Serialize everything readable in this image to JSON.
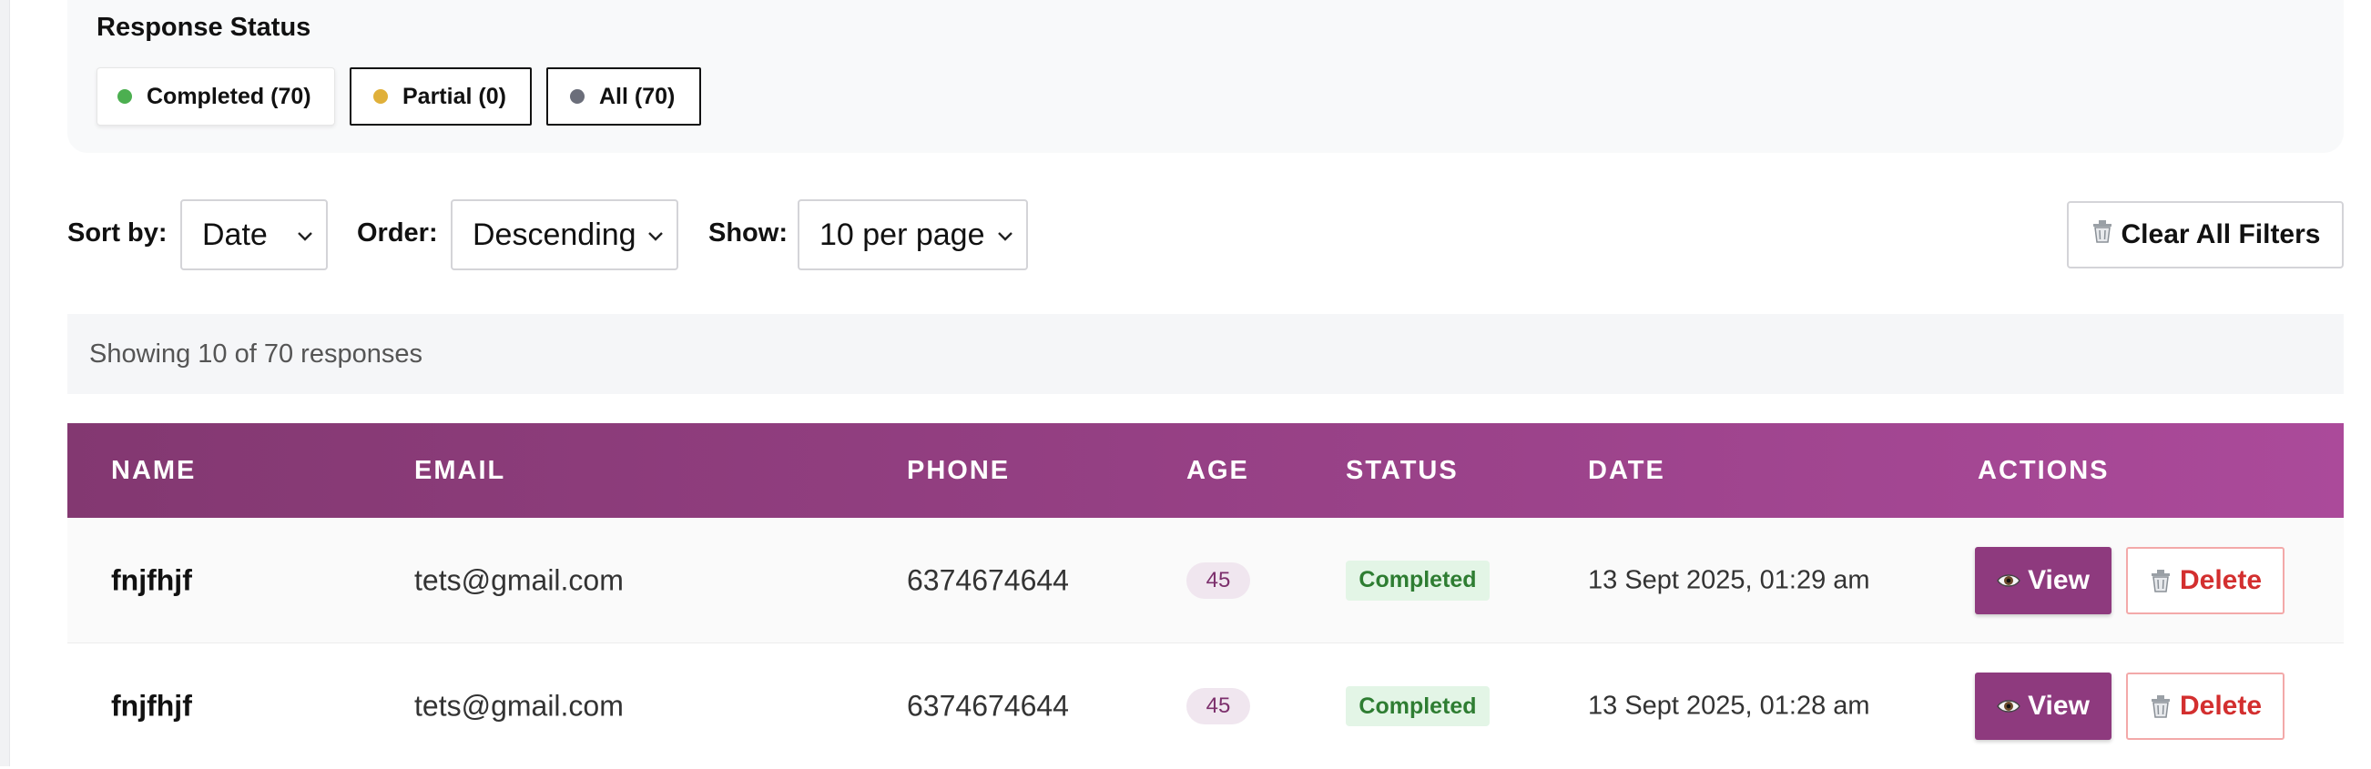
{
  "status_filter": {
    "title": "Response Status",
    "chips": [
      {
        "label": "Completed (70)",
        "color": "#4caf50"
      },
      {
        "label": "Partial (0)",
        "color": "#e0b03a"
      },
      {
        "label": "All (70)",
        "color": "#6b6e7a"
      }
    ]
  },
  "controls": {
    "sort_label": "Sort by:",
    "sort_value": "Date",
    "order_label": "Order:",
    "order_value": "Descending",
    "show_label": "Show:",
    "show_value": "10 per page",
    "clear_label": "Clear All Filters",
    "clear_icon": "trash-icon"
  },
  "summary": "Showing 10 of 70 responses",
  "table": {
    "headers": [
      "NAME",
      "EMAIL",
      "PHONE",
      "AGE",
      "STATUS",
      "DATE",
      "ACTIONS"
    ],
    "rows": [
      {
        "name": "fnjfhjf",
        "email": "tets@gmail.com",
        "phone": "6374674644",
        "age": "45",
        "status": "Completed",
        "date": "13 Sept 2025, 01:29 am"
      },
      {
        "name": "fnjfhjf",
        "email": "tets@gmail.com",
        "phone": "6374674644",
        "age": "45",
        "status": "Completed",
        "date": "13 Sept 2025, 01:28 am"
      }
    ],
    "view_label": "View",
    "delete_label": "Delete",
    "view_icon": "eye-icon",
    "delete_icon": "trash-icon"
  },
  "colors": {
    "accent": "#8e3a7e",
    "header_gradient_start": "#833871",
    "header_gradient_end": "#ab4a9a",
    "completed": "#2e7d32",
    "danger": "#d32f2f"
  }
}
